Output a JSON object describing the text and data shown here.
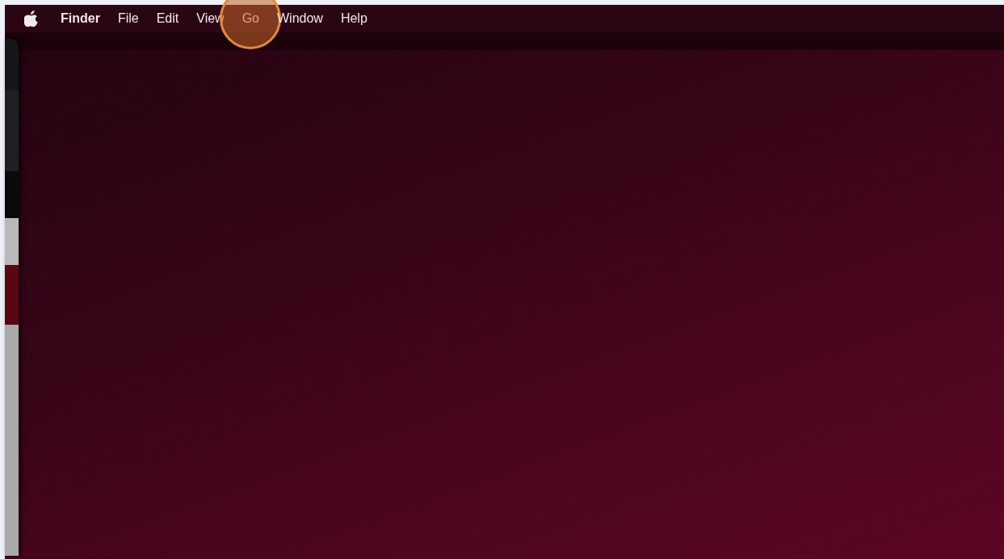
{
  "menu_bar": {
    "app_name": "Finder",
    "items": [
      {
        "label": "File",
        "selected": false
      },
      {
        "label": "Edit",
        "selected": false
      },
      {
        "label": "View",
        "selected": false
      },
      {
        "label": "Go",
        "selected": true
      },
      {
        "label": "Window",
        "selected": false
      },
      {
        "label": "Help",
        "selected": false
      }
    ]
  }
}
